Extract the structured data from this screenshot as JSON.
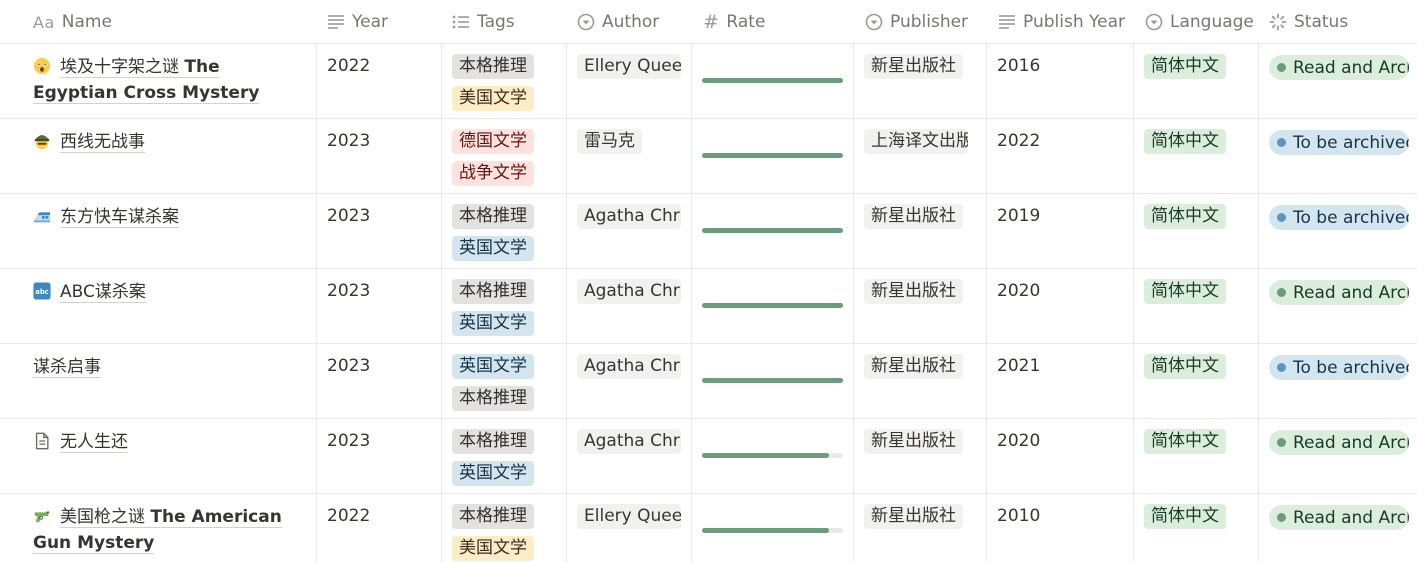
{
  "columns": {
    "name": "Name",
    "year": "Year",
    "tags": "Tags",
    "author": "Author",
    "rate": "Rate",
    "publisher": "Publisher",
    "publish_year": "Publish Year",
    "language": "Language",
    "status": "Status"
  },
  "header_icons": {
    "name": "Aa",
    "year": "lines-icon",
    "tags": "list-icon",
    "author": "select-icon",
    "rate": "#",
    "publisher": "select-icon",
    "publish_year": "lines-icon",
    "language": "select-icon",
    "status": "status-spinner-icon"
  },
  "colors": {
    "rate_fill": "#6c9b7d",
    "status_done_dot": "#6c9b7d",
    "status_todo_dot": "#5b97bd"
  },
  "rows": [
    {
      "emoji": "astonished-face-icon",
      "name_cn": "埃及十字架之谜 ",
      "name_en": "The Egyptian Cross Mystery",
      "year": "2022",
      "tags": [
        {
          "label": "本格推理",
          "color": "gray"
        },
        {
          "label": "美国文学",
          "color": "yellow"
        }
      ],
      "author": "Ellery Queen",
      "rate": 1.0,
      "publisher": "新星出版社",
      "publish_year": "2016",
      "language": "简体中文",
      "status": "Read and Archived",
      "status_color": "green"
    },
    {
      "emoji": "military-helmet-icon",
      "name_cn": "西线无战事",
      "name_en": "",
      "year": "2023",
      "tags": [
        {
          "label": "德国文学",
          "color": "red"
        },
        {
          "label": "战争文学",
          "color": "red"
        }
      ],
      "author": "雷马克",
      "rate": 1.0,
      "publisher": "上海译文出版社",
      "publish_year": "2022",
      "language": "简体中文",
      "status": "To be archived",
      "status_color": "blue"
    },
    {
      "emoji": "high-speed-train-icon",
      "name_cn": "东方快车谋杀案",
      "name_en": "",
      "year": "2023",
      "tags": [
        {
          "label": "本格推理",
          "color": "gray"
        },
        {
          "label": "英国文学",
          "color": "blue"
        }
      ],
      "author": "Agatha Christie",
      "rate": 1.0,
      "publisher": "新星出版社",
      "publish_year": "2019",
      "language": "简体中文",
      "status": "To be archived",
      "status_color": "blue"
    },
    {
      "emoji": "abc-icon",
      "name_cn": "ABC谋杀案",
      "name_en": "",
      "year": "2023",
      "tags": [
        {
          "label": "本格推理",
          "color": "gray"
        },
        {
          "label": "英国文学",
          "color": "blue"
        }
      ],
      "author": "Agatha Christie",
      "rate": 1.0,
      "publisher": "新星出版社",
      "publish_year": "2020",
      "language": "简体中文",
      "status": "Read and Archived",
      "status_color": "green"
    },
    {
      "emoji": "",
      "name_cn": "谋杀启事",
      "name_en": "",
      "year": "2023",
      "tags": [
        {
          "label": "英国文学",
          "color": "blue"
        },
        {
          "label": "本格推理",
          "color": "gray"
        }
      ],
      "author": "Agatha Christie",
      "rate": 1.0,
      "publisher": "新星出版社",
      "publish_year": "2021",
      "language": "简体中文",
      "status": "To be archived",
      "status_color": "blue"
    },
    {
      "emoji": "page-icon",
      "name_cn": "无人生还",
      "name_en": "",
      "year": "2023",
      "tags": [
        {
          "label": "本格推理",
          "color": "gray"
        },
        {
          "label": "英国文学",
          "color": "blue"
        }
      ],
      "author": "Agatha Christie",
      "rate": 0.9,
      "publisher": "新星出版社",
      "publish_year": "2020",
      "language": "简体中文",
      "status": "Read and Archived",
      "status_color": "green"
    },
    {
      "emoji": "water-pistol-icon",
      "name_cn": "美国枪之谜 ",
      "name_en": "The American Gun Mystery",
      "year": "2022",
      "tags": [
        {
          "label": "本格推理",
          "color": "gray"
        },
        {
          "label": "美国文学",
          "color": "yellow"
        }
      ],
      "author": "Ellery Queen",
      "rate": 0.9,
      "publisher": "新星出版社",
      "publish_year": "2010",
      "language": "简体中文",
      "status": "Read and Archived",
      "status_color": "green"
    }
  ]
}
